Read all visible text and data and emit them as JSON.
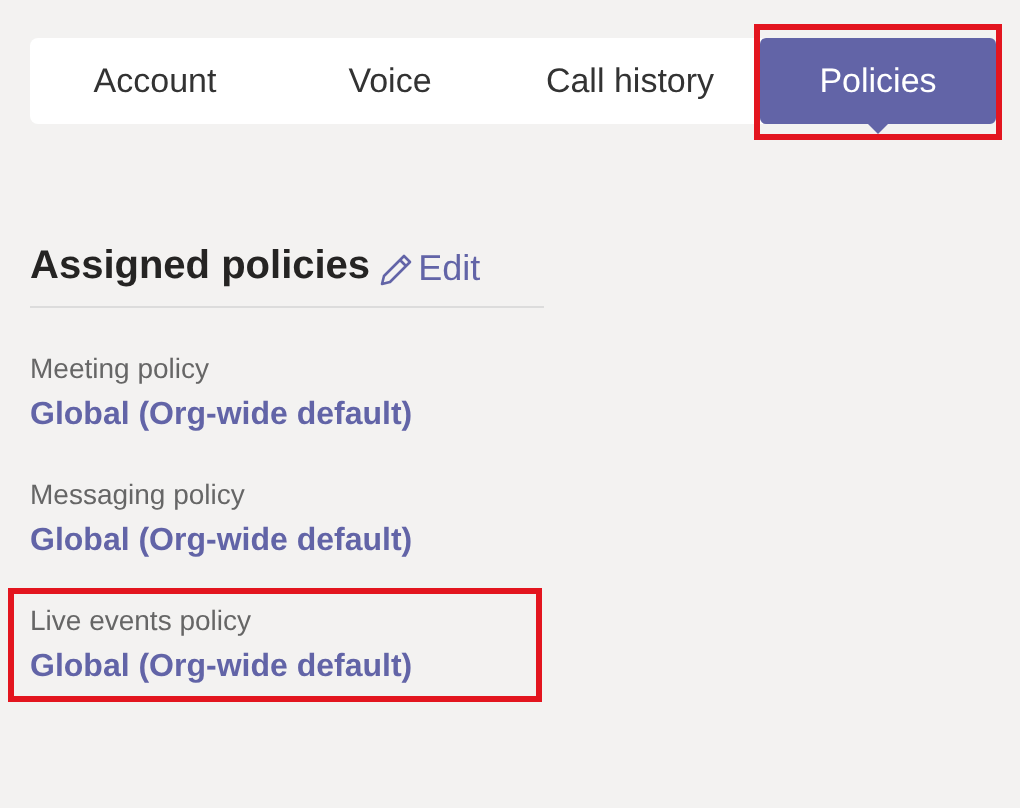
{
  "tabs": [
    {
      "label": "Account",
      "selected": false,
      "highlighted": false
    },
    {
      "label": "Voice",
      "selected": false,
      "highlighted": false
    },
    {
      "label": "Call history",
      "selected": false,
      "highlighted": false
    },
    {
      "label": "Policies",
      "selected": true,
      "highlighted": true
    }
  ],
  "section": {
    "title": "Assigned policies",
    "edit_label": "Edit"
  },
  "policies": [
    {
      "label": "Meeting policy",
      "value": "Global (Org-wide default)",
      "highlighted": false
    },
    {
      "label": "Messaging policy",
      "value": "Global (Org-wide default)",
      "highlighted": false
    },
    {
      "label": "Live events policy",
      "value": "Global (Org-wide default)",
      "highlighted": true
    }
  ]
}
